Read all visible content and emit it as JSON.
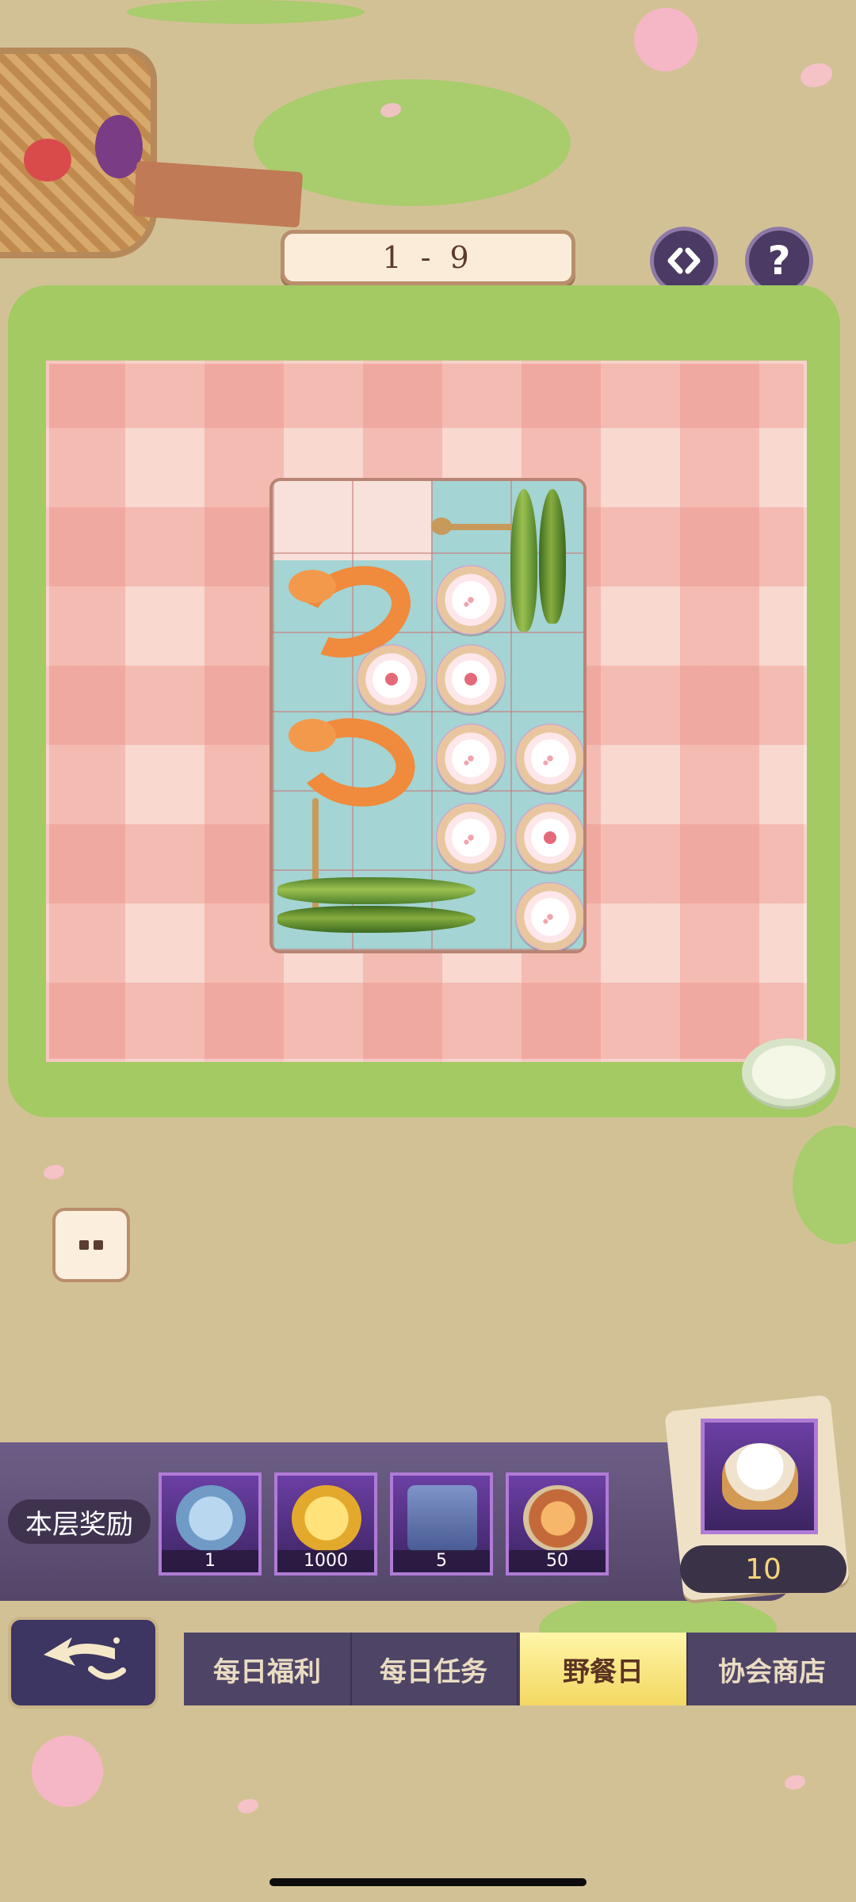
{
  "level": {
    "label": "1 - 9"
  },
  "header_buttons": {
    "swap_icon": "swap-arrows-icon",
    "help_label": "?"
  },
  "board": {
    "columns": 4,
    "rows": 6,
    "items": [
      "shrimp",
      "shrimp",
      "okra",
      "okra",
      "dessert",
      "dessert",
      "dessert",
      "dessert",
      "dessert",
      "dessert",
      "dessert",
      "dessert"
    ]
  },
  "rewards": {
    "title": "本层奖励",
    "items": [
      {
        "icon": "blue-coin-icon",
        "count": "1"
      },
      {
        "icon": "gold-pot-icon",
        "count": "1000"
      },
      {
        "icon": "anvil-icon",
        "count": "5"
      },
      {
        "icon": "winged-emblem-icon",
        "count": "50"
      }
    ],
    "bun": {
      "icon": "steamed-bun-icon",
      "count": "10"
    }
  },
  "nav": {
    "back_icon": "back-arrow-icon",
    "tabs": [
      {
        "label": "每日福利",
        "active": false
      },
      {
        "label": "每日任务",
        "active": false
      },
      {
        "label": "野餐日",
        "active": true
      },
      {
        "label": "协会商店",
        "active": false
      }
    ]
  }
}
